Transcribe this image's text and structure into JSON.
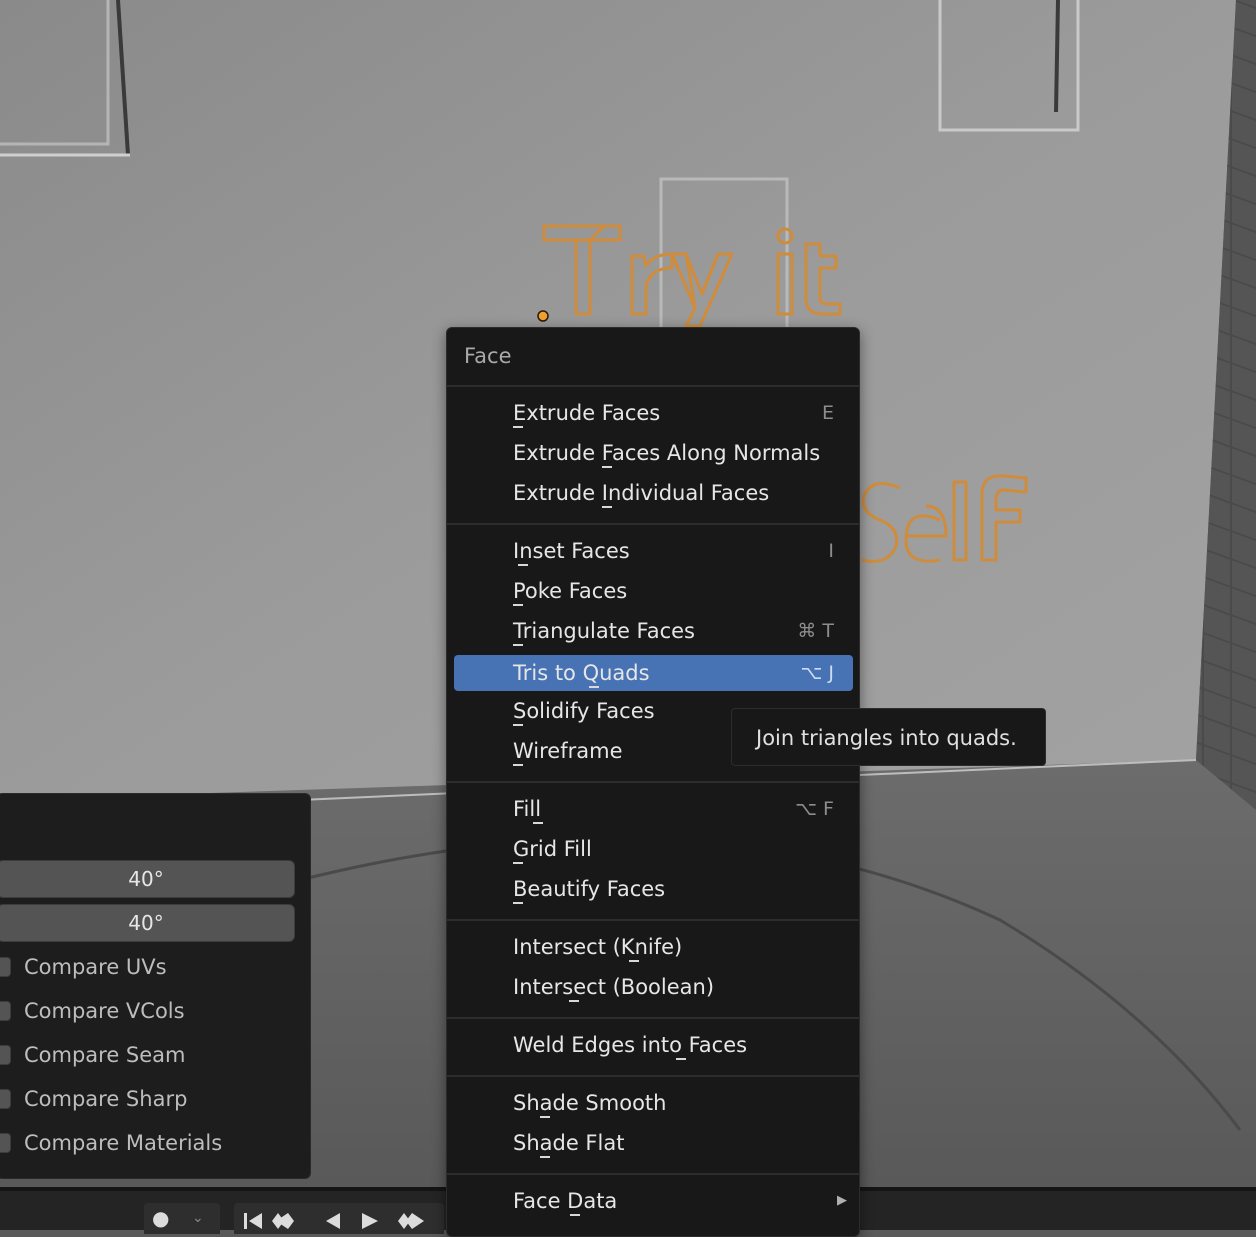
{
  "viewport": {
    "text_objects": [
      "Try it",
      "Self"
    ]
  },
  "menu": {
    "title": "Face",
    "items": [
      {
        "label": "Extrude Faces",
        "shortcut": "E"
      },
      {
        "label": "Extrude Faces Along Normals",
        "shortcut": ""
      },
      {
        "label": "Extrude Individual Faces",
        "shortcut": ""
      },
      {
        "label": "Inset Faces",
        "shortcut": "I"
      },
      {
        "label": "Poke Faces",
        "shortcut": ""
      },
      {
        "label": "Triangulate Faces",
        "shortcut": "⌘ T"
      },
      {
        "label": "Tris to Quads",
        "shortcut": "⌥ J"
      },
      {
        "label": "Solidify Faces",
        "shortcut": ""
      },
      {
        "label": "Wireframe",
        "shortcut": ""
      },
      {
        "label": "Fill",
        "shortcut": "⌥ F"
      },
      {
        "label": "Grid Fill",
        "shortcut": ""
      },
      {
        "label": "Beautify Faces",
        "shortcut": ""
      },
      {
        "label": "Intersect (Knife)",
        "shortcut": ""
      },
      {
        "label": "Intersect (Boolean)",
        "shortcut": ""
      },
      {
        "label": "Weld Edges into Faces",
        "shortcut": ""
      },
      {
        "label": "Shade Smooth",
        "shortcut": ""
      },
      {
        "label": "Shade Flat",
        "shortcut": ""
      },
      {
        "label": "Face Data",
        "shortcut": ""
      }
    ],
    "active_item": "Tris to Quads"
  },
  "tooltip": {
    "text": "Join triangles into quads."
  },
  "operator_panel": {
    "max_angle_face": "40°",
    "max_angle_shape": "40°",
    "checks": [
      {
        "label": "Compare UVs",
        "checked": false
      },
      {
        "label": "Compare VCols",
        "checked": false
      },
      {
        "label": "Compare Seam",
        "checked": false
      },
      {
        "label": "Compare Sharp",
        "checked": false
      },
      {
        "label": "Compare Materials",
        "checked": false
      }
    ]
  },
  "timeline": {
    "icons": [
      "record-icon",
      "chevron-down-icon",
      "jump-start-icon",
      "prev-keyframe-icon",
      "play-reverse-icon",
      "play-icon",
      "next-keyframe-icon"
    ]
  },
  "colors": {
    "menu_bg": "#181818",
    "highlight": "#4772b3",
    "text_object": "#d08c3a"
  }
}
